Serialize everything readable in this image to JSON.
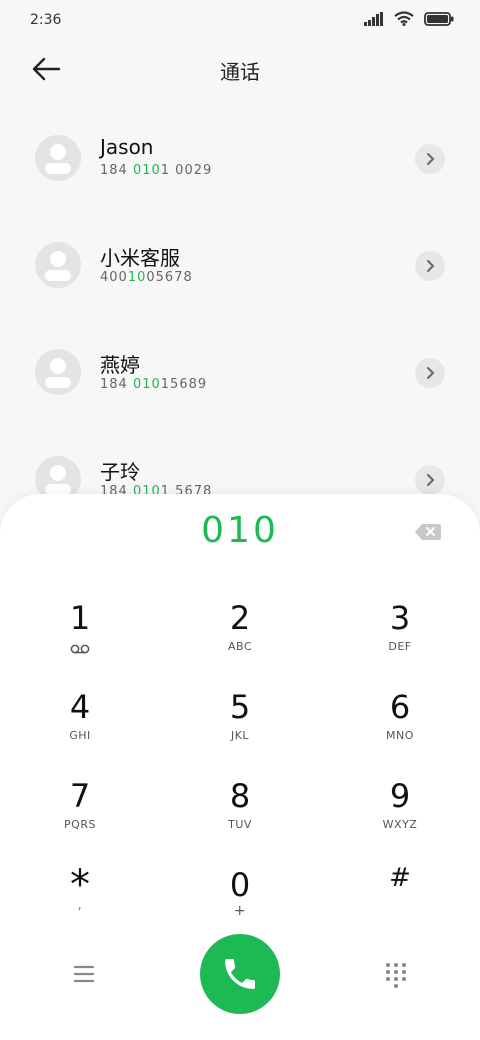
{
  "status_bar": {
    "time": "2:36"
  },
  "header": {
    "title": "通话"
  },
  "contacts": [
    {
      "name": "Jason",
      "num_prefix": "184 ",
      "num_match": "010",
      "num_suffix": "1 0029"
    },
    {
      "name": "小米客服",
      "num_prefix": "400",
      "num_match": "10",
      "num_suffix": "05678"
    },
    {
      "name": "燕婷",
      "num_prefix": "184 ",
      "num_match": "010",
      "num_suffix": "15689"
    },
    {
      "name": "子玲",
      "num_prefix": "184 ",
      "num_match": "010",
      "num_suffix": "1 5678"
    }
  ],
  "dialpad": {
    "input": "010",
    "keys": [
      {
        "digit": "1",
        "letters": ""
      },
      {
        "digit": "2",
        "letters": "ABC"
      },
      {
        "digit": "3",
        "letters": "DEF"
      },
      {
        "digit": "4",
        "letters": "GHI"
      },
      {
        "digit": "5",
        "letters": "JKL"
      },
      {
        "digit": "6",
        "letters": "MNO"
      },
      {
        "digit": "7",
        "letters": "PQRS"
      },
      {
        "digit": "8",
        "letters": "TUV"
      },
      {
        "digit": "9",
        "letters": "WXYZ"
      },
      {
        "digit": "*",
        "letters": ","
      },
      {
        "digit": "0",
        "letters": "+"
      },
      {
        "digit": "#",
        "letters": ""
      }
    ]
  },
  "icons": {
    "back": "arrow-left-icon",
    "backspace": "backspace-icon",
    "voicemail": "voicemail-icon",
    "menu": "menu-icon",
    "call": "phone-icon",
    "dialpad": "dialpad-grid-icon"
  },
  "colors": {
    "accent": "#1db954",
    "panel": "#ffffff",
    "background": "#f7f7f7"
  }
}
